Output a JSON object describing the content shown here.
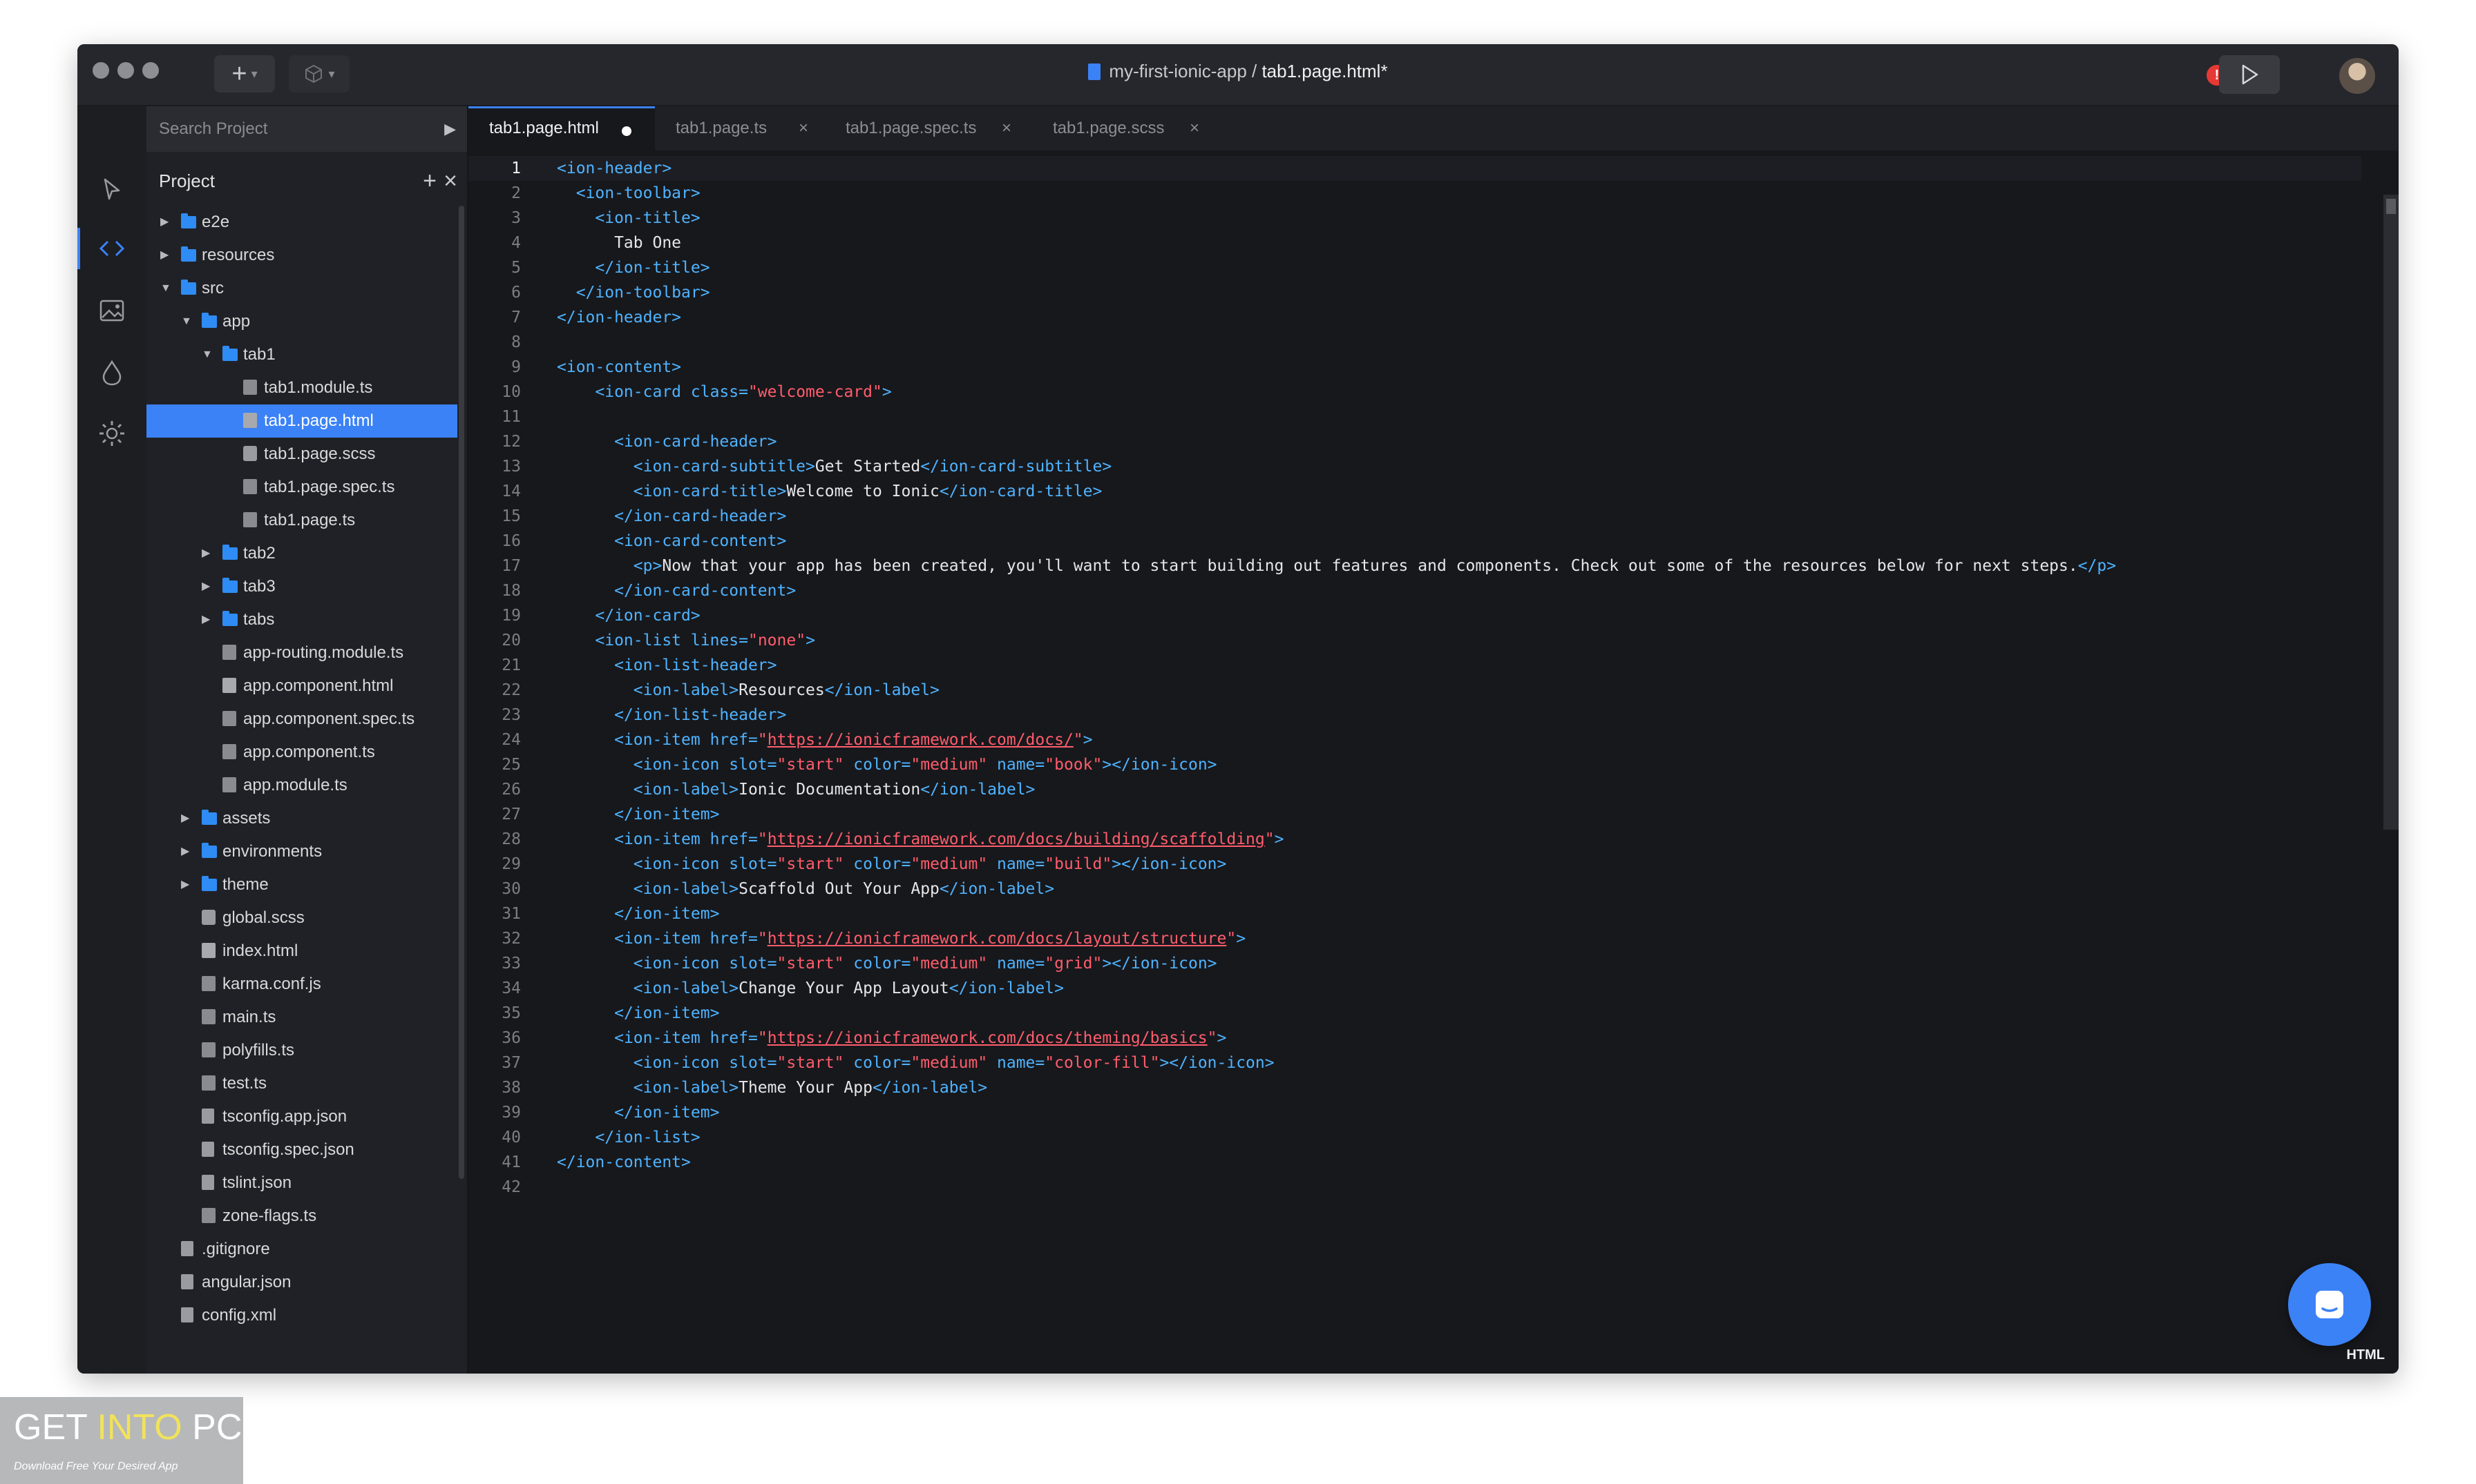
{
  "window": {
    "breadcrumb_project": "my-first-ionic-app",
    "breadcrumb_sep": " / ",
    "breadcrumb_file": "tab1.page.html*",
    "new_button": "+",
    "alert_icon": "!",
    "run_icon": "play-icon"
  },
  "sidebar": {
    "search_placeholder": "Search Project",
    "project_title": "Project",
    "add_label": "+",
    "close_label": "×",
    "tree": [
      {
        "label": "e2e",
        "kind": "folder",
        "depth": 0,
        "expanded": false
      },
      {
        "label": "resources",
        "kind": "folder",
        "depth": 0,
        "expanded": false
      },
      {
        "label": "src",
        "kind": "folder",
        "depth": 0,
        "expanded": true
      },
      {
        "label": "app",
        "kind": "folder",
        "depth": 1,
        "expanded": true
      },
      {
        "label": "tab1",
        "kind": "folder",
        "depth": 2,
        "expanded": true
      },
      {
        "label": "tab1.module.ts",
        "kind": "ts",
        "depth": 3
      },
      {
        "label": "tab1.page.html",
        "kind": "code",
        "depth": 3,
        "selected": true
      },
      {
        "label": "tab1.page.scss",
        "kind": "scss",
        "depth": 3
      },
      {
        "label": "tab1.page.spec.ts",
        "kind": "ts",
        "depth": 3
      },
      {
        "label": "tab1.page.ts",
        "kind": "ts",
        "depth": 3
      },
      {
        "label": "tab2",
        "kind": "folder",
        "depth": 2,
        "expanded": false
      },
      {
        "label": "tab3",
        "kind": "folder",
        "depth": 2,
        "expanded": false
      },
      {
        "label": "tabs",
        "kind": "folder",
        "depth": 2,
        "expanded": false
      },
      {
        "label": "app-routing.module.ts",
        "kind": "ts",
        "depth": 2
      },
      {
        "label": "app.component.html",
        "kind": "code",
        "depth": 2
      },
      {
        "label": "app.component.spec.ts",
        "kind": "ts",
        "depth": 2
      },
      {
        "label": "app.component.ts",
        "kind": "ts",
        "depth": 2
      },
      {
        "label": "app.module.ts",
        "kind": "ts",
        "depth": 2
      },
      {
        "label": "assets",
        "kind": "folder",
        "depth": 1,
        "expanded": false
      },
      {
        "label": "environments",
        "kind": "folder",
        "depth": 1,
        "expanded": false
      },
      {
        "label": "theme",
        "kind": "folder",
        "depth": 1,
        "expanded": false
      },
      {
        "label": "global.scss",
        "kind": "scss",
        "depth": 1
      },
      {
        "label": "index.html",
        "kind": "code",
        "depth": 1
      },
      {
        "label": "karma.conf.js",
        "kind": "ts",
        "depth": 1
      },
      {
        "label": "main.ts",
        "kind": "ts",
        "depth": 1
      },
      {
        "label": "polyfills.ts",
        "kind": "ts",
        "depth": 1
      },
      {
        "label": "test.ts",
        "kind": "ts",
        "depth": 1
      },
      {
        "label": "tsconfig.app.json",
        "kind": "file",
        "depth": 1
      },
      {
        "label": "tsconfig.spec.json",
        "kind": "file",
        "depth": 1
      },
      {
        "label": "tslint.json",
        "kind": "file",
        "depth": 1
      },
      {
        "label": "zone-flags.ts",
        "kind": "ts",
        "depth": 1
      },
      {
        "label": ".gitignore",
        "kind": "file",
        "depth": 0
      },
      {
        "label": "angular.json",
        "kind": "file",
        "depth": 0
      },
      {
        "label": "config.xml",
        "kind": "file",
        "depth": 0
      }
    ]
  },
  "tabs": [
    {
      "label": "tab1.page.html",
      "active": true,
      "modified": true
    },
    {
      "label": "tab1.page.ts",
      "active": false
    },
    {
      "label": "tab1.page.spec.ts",
      "active": false
    },
    {
      "label": "tab1.page.scss",
      "active": false
    }
  ],
  "editor": {
    "language": "HTML",
    "current_line": 1,
    "lines": [
      [
        [
          "t",
          "<ion-header>"
        ]
      ],
      [
        [
          "txt",
          "  "
        ],
        [
          "t",
          "<ion-toolbar>"
        ]
      ],
      [
        [
          "txt",
          "    "
        ],
        [
          "t",
          "<ion-title>"
        ]
      ],
      [
        [
          "txt",
          "      Tab One"
        ]
      ],
      [
        [
          "txt",
          "    "
        ],
        [
          "t",
          "</ion-title>"
        ]
      ],
      [
        [
          "txt",
          "  "
        ],
        [
          "t",
          "</ion-toolbar>"
        ]
      ],
      [
        [
          "t",
          "</ion-header>"
        ]
      ],
      [],
      [
        [
          "t",
          "<ion-content>"
        ]
      ],
      [
        [
          "txt",
          "    "
        ],
        [
          "t",
          "<ion-card "
        ],
        [
          "a",
          "class="
        ],
        [
          "s",
          "\"welcome-card\""
        ],
        [
          "t",
          ">"
        ]
      ],
      [],
      [
        [
          "txt",
          "      "
        ],
        [
          "t",
          "<ion-card-header>"
        ]
      ],
      [
        [
          "txt",
          "        "
        ],
        [
          "t",
          "<ion-card-subtitle>"
        ],
        [
          "txt",
          "Get Started"
        ],
        [
          "t",
          "</ion-card-subtitle>"
        ]
      ],
      [
        [
          "txt",
          "        "
        ],
        [
          "t",
          "<ion-card-title>"
        ],
        [
          "txt",
          "Welcome to Ionic"
        ],
        [
          "t",
          "</ion-card-title>"
        ]
      ],
      [
        [
          "txt",
          "      "
        ],
        [
          "t",
          "</ion-card-header>"
        ]
      ],
      [
        [
          "txt",
          "      "
        ],
        [
          "t",
          "<ion-card-content>"
        ]
      ],
      [
        [
          "txt",
          "        "
        ],
        [
          "t",
          "<p>"
        ],
        [
          "txt",
          "Now that your app has been created, you'll want to start building out features and components. Check out some of the resources below for next steps."
        ],
        [
          "t",
          "</p>"
        ]
      ],
      [
        [
          "txt",
          "      "
        ],
        [
          "t",
          "</ion-card-content>"
        ]
      ],
      [
        [
          "txt",
          "    "
        ],
        [
          "t",
          "</ion-card>"
        ]
      ],
      [
        [
          "txt",
          "    "
        ],
        [
          "t",
          "<ion-list "
        ],
        [
          "a",
          "lines="
        ],
        [
          "s",
          "\"none\""
        ],
        [
          "t",
          ">"
        ]
      ],
      [
        [
          "txt",
          "      "
        ],
        [
          "t",
          "<ion-list-header>"
        ]
      ],
      [
        [
          "txt",
          "        "
        ],
        [
          "t",
          "<ion-label>"
        ],
        [
          "txt",
          "Resources"
        ],
        [
          "t",
          "</ion-label>"
        ]
      ],
      [
        [
          "txt",
          "      "
        ],
        [
          "t",
          "</ion-list-header>"
        ]
      ],
      [
        [
          "txt",
          "      "
        ],
        [
          "t",
          "<ion-item "
        ],
        [
          "a",
          "href="
        ],
        [
          "s",
          "\""
        ],
        [
          "u",
          "https://ionicframework.com/docs/"
        ],
        [
          "s",
          "\""
        ],
        [
          "t",
          ">"
        ]
      ],
      [
        [
          "txt",
          "        "
        ],
        [
          "t",
          "<ion-icon "
        ],
        [
          "a",
          "slot="
        ],
        [
          "s",
          "\"start\" "
        ],
        [
          "a",
          "color="
        ],
        [
          "s",
          "\"medium\" "
        ],
        [
          "a",
          "name="
        ],
        [
          "s",
          "\"book\""
        ],
        [
          "t",
          "></ion-icon>"
        ]
      ],
      [
        [
          "txt",
          "        "
        ],
        [
          "t",
          "<ion-label>"
        ],
        [
          "txt",
          "Ionic Documentation"
        ],
        [
          "t",
          "</ion-label>"
        ]
      ],
      [
        [
          "txt",
          "      "
        ],
        [
          "t",
          "</ion-item>"
        ]
      ],
      [
        [
          "txt",
          "      "
        ],
        [
          "t",
          "<ion-item "
        ],
        [
          "a",
          "href="
        ],
        [
          "s",
          "\""
        ],
        [
          "u",
          "https://ionicframework.com/docs/building/scaffolding"
        ],
        [
          "s",
          "\""
        ],
        [
          "t",
          ">"
        ]
      ],
      [
        [
          "txt",
          "        "
        ],
        [
          "t",
          "<ion-icon "
        ],
        [
          "a",
          "slot="
        ],
        [
          "s",
          "\"start\" "
        ],
        [
          "a",
          "color="
        ],
        [
          "s",
          "\"medium\" "
        ],
        [
          "a",
          "name="
        ],
        [
          "s",
          "\"build\""
        ],
        [
          "t",
          "></ion-icon>"
        ]
      ],
      [
        [
          "txt",
          "        "
        ],
        [
          "t",
          "<ion-label>"
        ],
        [
          "txt",
          "Scaffold Out Your App"
        ],
        [
          "t",
          "</ion-label>"
        ]
      ],
      [
        [
          "txt",
          "      "
        ],
        [
          "t",
          "</ion-item>"
        ]
      ],
      [
        [
          "txt",
          "      "
        ],
        [
          "t",
          "<ion-item "
        ],
        [
          "a",
          "href="
        ],
        [
          "s",
          "\""
        ],
        [
          "u",
          "https://ionicframework.com/docs/layout/structure"
        ],
        [
          "s",
          "\""
        ],
        [
          "t",
          ">"
        ]
      ],
      [
        [
          "txt",
          "        "
        ],
        [
          "t",
          "<ion-icon "
        ],
        [
          "a",
          "slot="
        ],
        [
          "s",
          "\"start\" "
        ],
        [
          "a",
          "color="
        ],
        [
          "s",
          "\"medium\" "
        ],
        [
          "a",
          "name="
        ],
        [
          "s",
          "\"grid\""
        ],
        [
          "t",
          "></ion-icon>"
        ]
      ],
      [
        [
          "txt",
          "        "
        ],
        [
          "t",
          "<ion-label>"
        ],
        [
          "txt",
          "Change Your App Layout"
        ],
        [
          "t",
          "</ion-label>"
        ]
      ],
      [
        [
          "txt",
          "      "
        ],
        [
          "t",
          "</ion-item>"
        ]
      ],
      [
        [
          "txt",
          "      "
        ],
        [
          "t",
          "<ion-item "
        ],
        [
          "a",
          "href="
        ],
        [
          "s",
          "\""
        ],
        [
          "u",
          "https://ionicframework.com/docs/theming/basics"
        ],
        [
          "s",
          "\""
        ],
        [
          "t",
          ">"
        ]
      ],
      [
        [
          "txt",
          "        "
        ],
        [
          "t",
          "<ion-icon "
        ],
        [
          "a",
          "slot="
        ],
        [
          "s",
          "\"start\" "
        ],
        [
          "a",
          "color="
        ],
        [
          "s",
          "\"medium\" "
        ],
        [
          "a",
          "name="
        ],
        [
          "s",
          "\"color-fill\""
        ],
        [
          "t",
          "></ion-icon>"
        ]
      ],
      [
        [
          "txt",
          "        "
        ],
        [
          "t",
          "<ion-label>"
        ],
        [
          "txt",
          "Theme Your App"
        ],
        [
          "t",
          "</ion-label>"
        ]
      ],
      [
        [
          "txt",
          "      "
        ],
        [
          "t",
          "</ion-item>"
        ]
      ],
      [
        [
          "txt",
          "    "
        ],
        [
          "t",
          "</ion-list>"
        ]
      ],
      [
        [
          "t",
          "</ion-content>"
        ]
      ],
      []
    ]
  },
  "watermark": {
    "get": "GET ",
    "into": "INTO",
    "pc": " PC",
    "tagline": "Download Free Your Desired App"
  },
  "colors": {
    "accent": "#3b82f6",
    "tag": "#4fb3ff",
    "string": "#ff5d6c",
    "background": "#17181c"
  }
}
